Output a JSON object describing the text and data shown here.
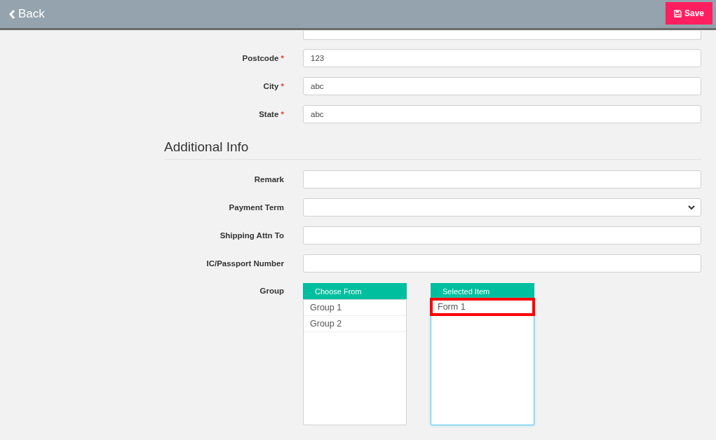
{
  "header": {
    "back_label": "Back",
    "save_label": "Save"
  },
  "shipping_section": {
    "fields": [
      {
        "label": "Postcode",
        "required_mark": "*",
        "value": "123"
      },
      {
        "label": "City",
        "required_mark": "*",
        "value": "abc"
      },
      {
        "label": "State",
        "required_mark": "*",
        "value": "abc"
      }
    ]
  },
  "additional_section": {
    "title": "Additional Info",
    "fields": [
      {
        "label": "Remark",
        "kind": "text"
      },
      {
        "label": "Payment Term",
        "kind": "select"
      },
      {
        "label": "Shipping Attn To",
        "kind": "text"
      },
      {
        "label": "IC/Passport Number",
        "kind": "text"
      }
    ]
  },
  "group": {
    "label": "Group",
    "choose_title": "Choose From",
    "choose_items": [
      {
        "label": "Group 1",
        "highlighted": false
      },
      {
        "label": "Group 2",
        "highlighted": false
      }
    ],
    "selected_title": "Selected Item",
    "selected_items": [
      {
        "label": "Form 1",
        "highlighted": true
      }
    ],
    "selected_focused": true
  }
}
